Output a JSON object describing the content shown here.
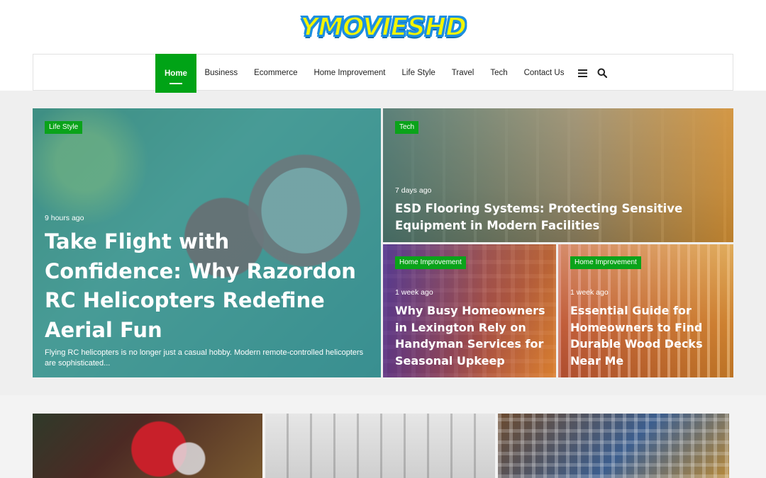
{
  "site": {
    "logo_text": "YMOVIESHD"
  },
  "nav": {
    "items": [
      {
        "label": "Home",
        "active": true
      },
      {
        "label": "Business"
      },
      {
        "label": "Ecommerce"
      },
      {
        "label": "Home Improvement"
      },
      {
        "label": "Life Style"
      },
      {
        "label": "Travel"
      },
      {
        "label": "Tech"
      },
      {
        "label": "Contact Us"
      }
    ],
    "icons": [
      "menu-icon",
      "search-icon"
    ]
  },
  "featured": [
    {
      "category": "Life Style",
      "time": "9 hours ago",
      "title": "Take Flight with Confidence: Why Razordon RC Helicopters Redefine Aerial Fun",
      "excerpt": "Flying RC helicopters is no longer just a casual hobby. Modern remote-controlled helicopters are sophisticated..."
    },
    {
      "category": "Tech",
      "time": "7 days ago",
      "title": "ESD Flooring Systems: Protecting Sensitive Equipment in Modern Facilities"
    },
    {
      "category": "Home Improvement",
      "time": "1 week ago",
      "title": "Why Busy Homeowners in Lexington Rely on Handyman Services for Seasonal Upkeep"
    },
    {
      "category": "Home Improvement",
      "time": "1 week ago",
      "title": "Essential Guide for Homeowners to Find Durable Wood Decks Near Me"
    }
  ],
  "colors": {
    "accent": "#00a316",
    "badge": "#0aa31a"
  }
}
